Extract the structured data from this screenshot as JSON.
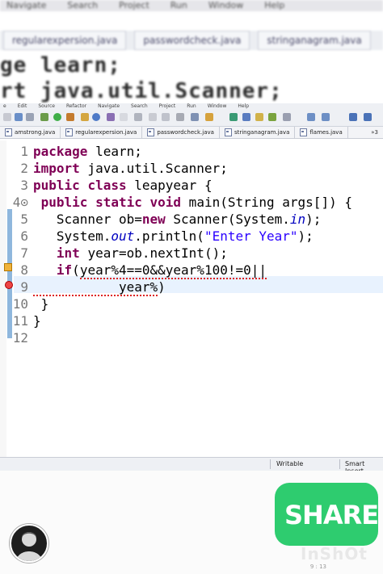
{
  "background": {
    "menu": [
      "Navigate",
      "Search",
      "Project",
      "Run",
      "Window",
      "Help"
    ],
    "tabs": [
      "regularexpersion.java",
      "passwordcheck.java",
      "stringanagram.java"
    ],
    "line1": "ge learn;",
    "line2": "rt java.util.Scanner;"
  },
  "ide": {
    "menu": [
      "e",
      "Edit",
      "Source",
      "Refactor",
      "Navigate",
      "Search",
      "Project",
      "Run",
      "Window",
      "Help"
    ],
    "tabs": [
      "amstrong.java",
      "regularexpersion.java",
      "passwordcheck.java",
      "stringanagram.java",
      "flames.java"
    ],
    "tab_overflow": "»3"
  },
  "code": {
    "line_numbers": [
      "1",
      "2",
      "3",
      "4⊙",
      "5",
      "6",
      "7",
      "8",
      "9",
      "10",
      "11",
      "12"
    ],
    "current_line": 9
  },
  "status": {
    "writable": "Writable",
    "insert_mode": "Smart Insert",
    "position": "9 : 13"
  },
  "overlay": {
    "share_label": "SHARE",
    "inshot_label": "InShOt"
  },
  "colors": {
    "keyword": "#7f0055",
    "string": "#2a00ff",
    "static_field": "#0000c0",
    "share_green": "#2ecc6f"
  }
}
